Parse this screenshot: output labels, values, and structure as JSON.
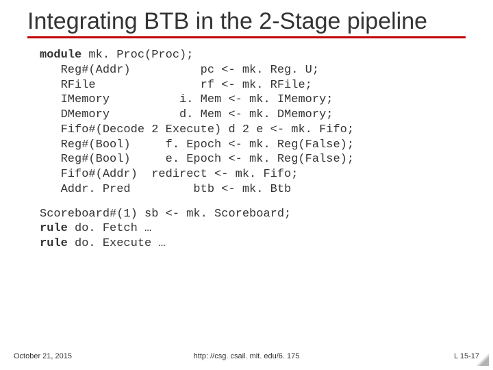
{
  "title": "Integrating BTB in the 2-Stage pipeline",
  "code": {
    "kw_module": "module",
    "l1_rest": " mk. Proc(Proc);",
    "l2": "   Reg#(Addr)          pc <- mk. Reg. U;",
    "l3": "   RFile               rf <- mk. RFile;",
    "l4": "   IMemory          i. Mem <- mk. IMemory;",
    "l5": "   DMemory          d. Mem <- mk. DMemory;",
    "l6": "   Fifo#(Decode 2 Execute) d 2 e <- mk. Fifo;",
    "l7": "   Reg#(Bool)     f. Epoch <- mk. Reg(False);",
    "l8": "   Reg#(Bool)     e. Epoch <- mk. Reg(False);",
    "l9": "   Fifo#(Addr)  redirect <- mk. Fifo;",
    "l10": "   Addr. Pred         btb <- mk. Btb",
    "b2l1": "Scoreboard#(1) sb <- mk. Scoreboard;",
    "kw_rule1": "rule",
    "b2l2_rest": " do. Fetch …",
    "kw_rule2": "rule",
    "b2l3_rest": " do. Execute …"
  },
  "footer": {
    "date": "October 21, 2015",
    "url": "http: //csg. csail. mit. edu/6. 175",
    "page": "L 15-17"
  }
}
